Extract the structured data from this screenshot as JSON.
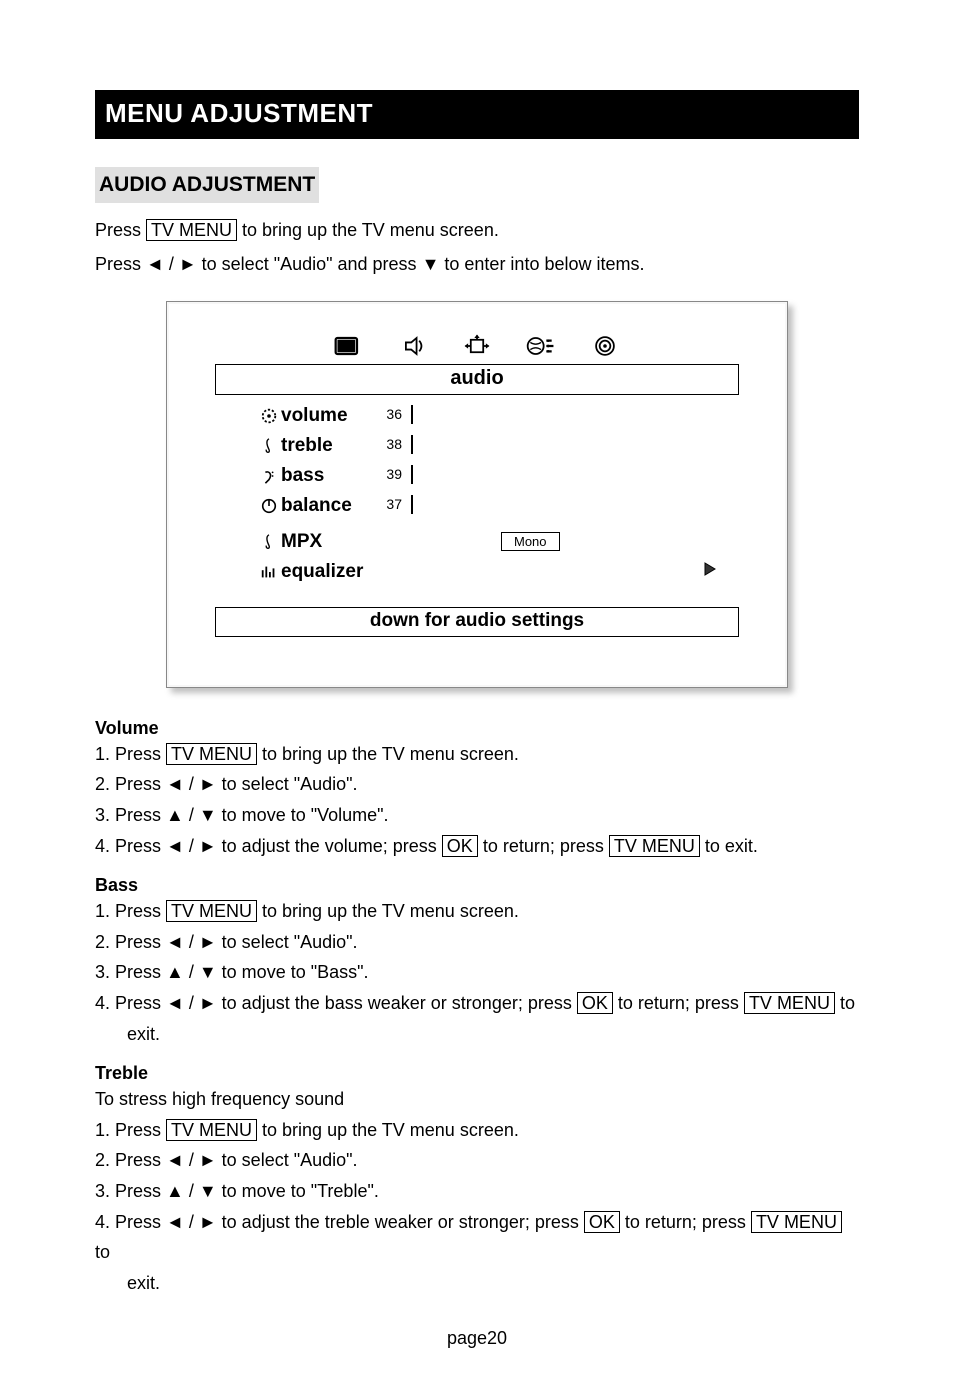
{
  "title_bar": "MENU ADJUSTMENT",
  "section_head": "AUDIO ADJUSTMENT",
  "intro1_a": "Press ",
  "intro1_btn": "TV MENU",
  "intro1_b": " to bring up the TV menu screen.",
  "intro2_a": "Press ",
  "intro2_arrows": "◄ / ►",
  "intro2_b": " to select \"Audio\" and press ",
  "intro2_down": "▼",
  "intro2_c": " to enter into below items.",
  "osd": {
    "title": "audio",
    "rows": {
      "volume": {
        "label": "volume",
        "value": "36",
        "fill_pct": 36
      },
      "treble": {
        "label": "treble",
        "value": "38",
        "fill_pct": 38
      },
      "bass": {
        "label": "bass",
        "value": "39",
        "fill_pct": 39
      },
      "balance": {
        "label": "balance",
        "value": "37",
        "fill_pct": 37
      },
      "mpx": {
        "label": "MPX",
        "value": "Mono"
      },
      "equalizer": {
        "label": "equalizer"
      }
    },
    "footer": "down for audio settings"
  },
  "volume_head": "Volume",
  "vol_s1_a": "1. Press ",
  "vol_s1_btn": "TV MENU",
  "vol_s1_b": " to bring up the TV menu screen.",
  "vol_s2_a": "2. Press ",
  "vol_s2_arrows": "◄ / ►",
  "vol_s2_b": " to select \"Audio\".",
  "vol_s3_a": "3. Press ",
  "vol_s3_arrows": "▲ / ▼",
  "vol_s3_b": " to move to \"Volume\".",
  "vol_s4_a": "4. Press ",
  "vol_s4_arrows": "◄ / ►",
  "vol_s4_b": " to adjust the volume; press ",
  "vol_s4_ok": "OK",
  "vol_s4_c": " to return; press ",
  "vol_s4_btn2": "TV MENU",
  "vol_s4_d": " to exit.",
  "bass_head": "Bass",
  "bass_s1_a": "1. Press ",
  "bass_s1_btn": "TV MENU",
  "bass_s1_b": " to bring up the TV menu screen.",
  "bass_s2_a": "2. Press ",
  "bass_s2_arrows": "◄ / ►",
  "bass_s2_b": " to select \"Audio\".",
  "bass_s3_a": "3. Press ",
  "bass_s3_arrows": "▲ / ▼",
  "bass_s3_b": " to move to \"Bass\".",
  "bass_s4_a": "4. Press ",
  "bass_s4_arrows": "◄ / ►",
  "bass_s4_b": " to adjust the bass weaker or stronger; press ",
  "bass_s4_ok": "OK",
  "bass_s4_c": " to return; press ",
  "bass_s4_btn2": "TV MENU",
  "bass_s4_d": " to",
  "bass_s4_exit": "exit.",
  "treble_head": "Treble",
  "treble_sub": "To stress high frequency sound",
  "treb_s1_a": "1. Press ",
  "treb_s1_btn": "TV MENU",
  "treb_s1_b": " to bring up the TV menu screen.",
  "treb_s2_a": "2. Press ",
  "treb_s2_arrows": "◄ / ►",
  "treb_s2_b": " to select \"Audio\".",
  "treb_s3_a": "3. Press ",
  "treb_s3_arrows": "▲ / ▼",
  "treb_s3_b": " to move to \"Treble\".",
  "treb_s4_a": "4. Press ",
  "treb_s4_arrows": "◄ / ►",
  "treb_s4_b": " to adjust the treble weaker or stronger; press ",
  "treb_s4_ok": "OK",
  "treb_s4_c": " to return; press ",
  "treb_s4_btn2": "TV MENU",
  "treb_s4_d": " to",
  "treb_s4_exit": "exit.",
  "page_num": "page20"
}
